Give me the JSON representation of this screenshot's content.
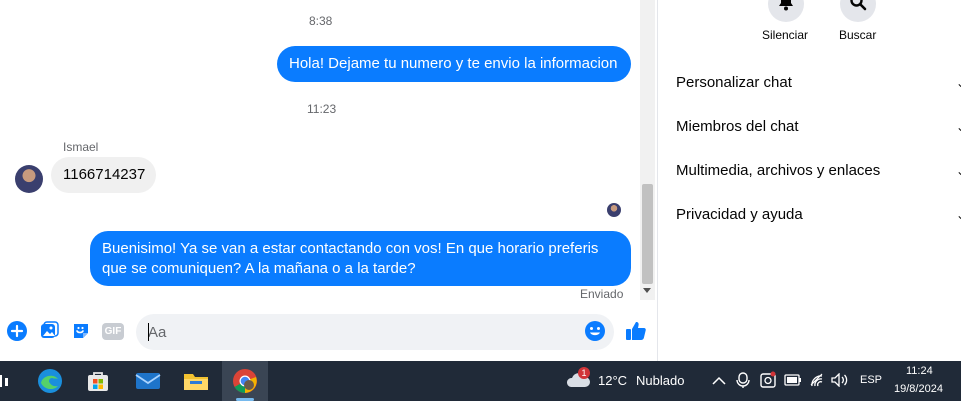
{
  "messages": {
    "time1": "8:38",
    "out1": "Hola! Dejame tu numero y te envio la informacion",
    "time2": "11:23",
    "sender": "Ismael",
    "in1": "1166714237",
    "out2": "Buenisimo! Ya se van a estar contactando con vos! En que horario preferis que se comuniquen? A la mañana o a la tarde?",
    "status": "Enviado"
  },
  "composer": {
    "placeholder": "Aa",
    "gif_label": "GIF"
  },
  "side": {
    "mute_label": "Silenciar",
    "search_label": "Buscar",
    "items": [
      "Personalizar chat",
      "Miembros del chat",
      "Multimedia, archivos y enlaces",
      "Privacidad y ayuda"
    ]
  },
  "taskbar": {
    "weather_temp": "12°C",
    "weather_desc": "Nublado",
    "weather_badge": "1",
    "lang": "ESP",
    "time": "11:24",
    "date": "19/8/2024"
  },
  "colors": {
    "accent": "#0a7cff",
    "incoming": "#f0f0f0",
    "taskbar": "#202a38"
  }
}
